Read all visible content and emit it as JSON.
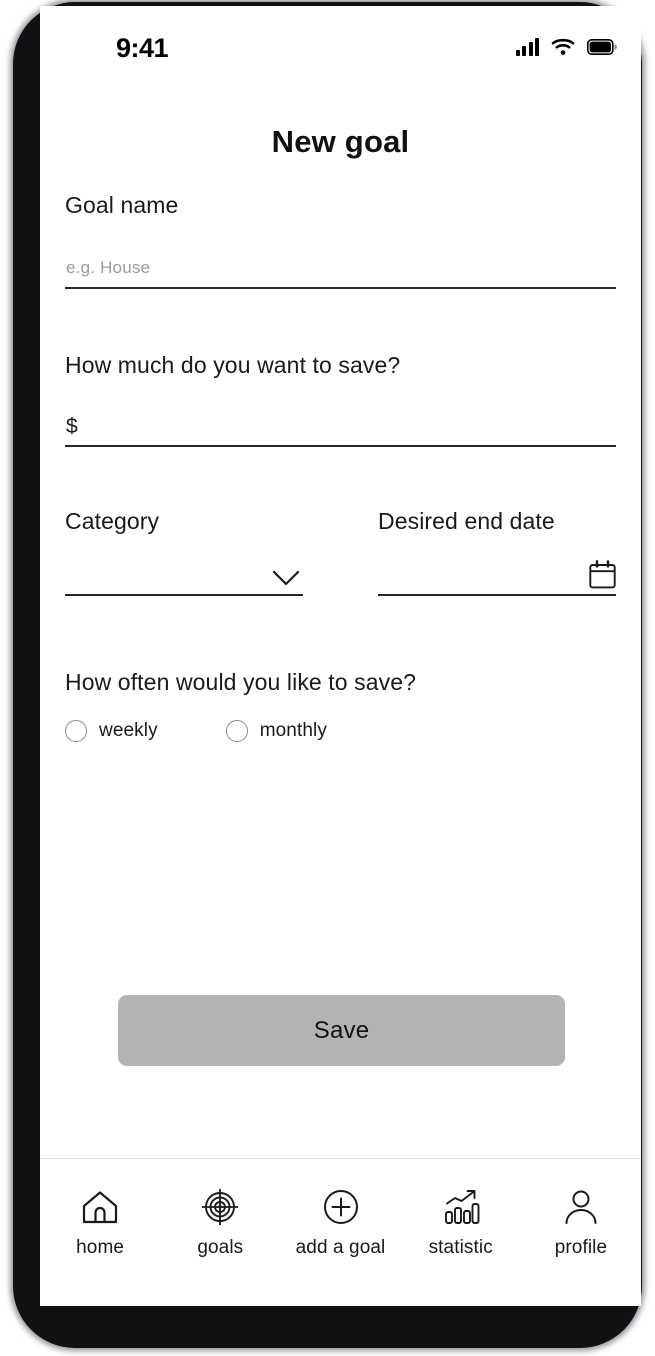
{
  "status_bar": {
    "time": "9:41",
    "signal_icon": "cellular-signal-icon",
    "wifi_icon": "wifi-icon",
    "battery_icon": "battery-full-icon"
  },
  "header": {
    "title": "New goal"
  },
  "form": {
    "goal_name": {
      "label": "Goal name",
      "placeholder": "e.g. House",
      "value": ""
    },
    "amount": {
      "label": "How much do you want to save?",
      "prefix": "$",
      "value": ""
    },
    "category": {
      "label": "Category",
      "value": "",
      "dropdown_icon": "chevron-down-icon"
    },
    "end_date": {
      "label": "Desired end date",
      "value": "",
      "calendar_icon": "calendar-icon"
    },
    "frequency": {
      "label": "How often would you like to save?",
      "options": [
        {
          "label": "weekly",
          "selected": false
        },
        {
          "label": "monthly",
          "selected": false
        }
      ]
    }
  },
  "actions": {
    "save_label": "Save",
    "save_color": "#b3b3b3"
  },
  "bottom_nav": {
    "items": [
      {
        "label": "home",
        "icon": "home-icon"
      },
      {
        "label": "goals",
        "icon": "target-icon"
      },
      {
        "label": "add a goal",
        "icon": "plus-circle-icon"
      },
      {
        "label": "statistic",
        "icon": "bar-chart-trend-icon"
      },
      {
        "label": "profile",
        "icon": "person-icon"
      }
    ]
  }
}
